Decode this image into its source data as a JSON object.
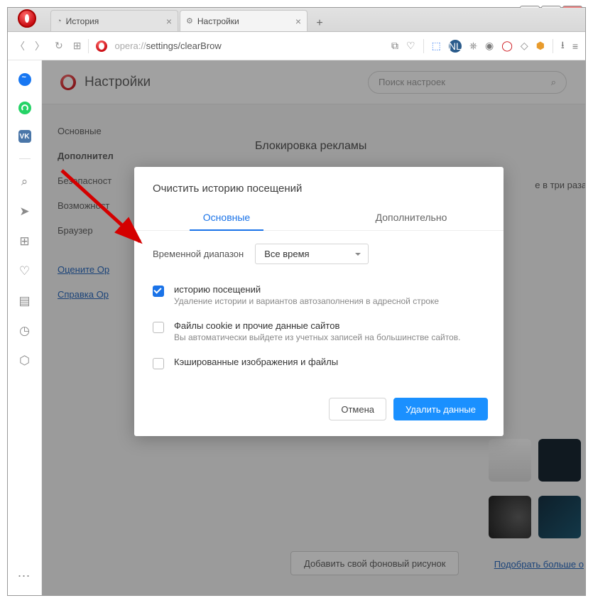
{
  "tabs": {
    "history": "История",
    "settings": "Настройки"
  },
  "url": {
    "protocol": "opera://",
    "path": "settings/clearBrow"
  },
  "page": {
    "title": "Настройки",
    "search_placeholder": "Поиск настроек",
    "section": "Блокировка рекламы",
    "partial": "е в три раза бь"
  },
  "sidenav": {
    "basic": "Основные",
    "advanced": "Дополнител",
    "security": "Безопасност",
    "features": "Возможност",
    "browser": "Браузер",
    "rate": "Оцените Op",
    "help": "Справка Op"
  },
  "modal": {
    "title": "Очистить историю посещений",
    "tab_basic": "Основные",
    "tab_advanced": "Дополнительно",
    "time_label": "Временной диапазон",
    "time_value": "Все время",
    "items": [
      {
        "checked": true,
        "title": "историю посещений",
        "sub": "Удаление истории и вариантов автозаполнения в адресной строке"
      },
      {
        "checked": false,
        "title": "Файлы cookie и прочие данные сайтов",
        "sub": "Вы автоматически выйдете из учетных записей на большинстве сайтов."
      },
      {
        "checked": false,
        "title": "Кэшированные изображения и файлы",
        "sub": ""
      }
    ],
    "cancel": "Отмена",
    "confirm": "Удалить данные"
  },
  "bottom": {
    "add_bg": "Добавить свой фоновый рисунок",
    "more_bg": "Подобрать больше о"
  },
  "rail": {
    "vk": "VK"
  },
  "nl": "NL"
}
